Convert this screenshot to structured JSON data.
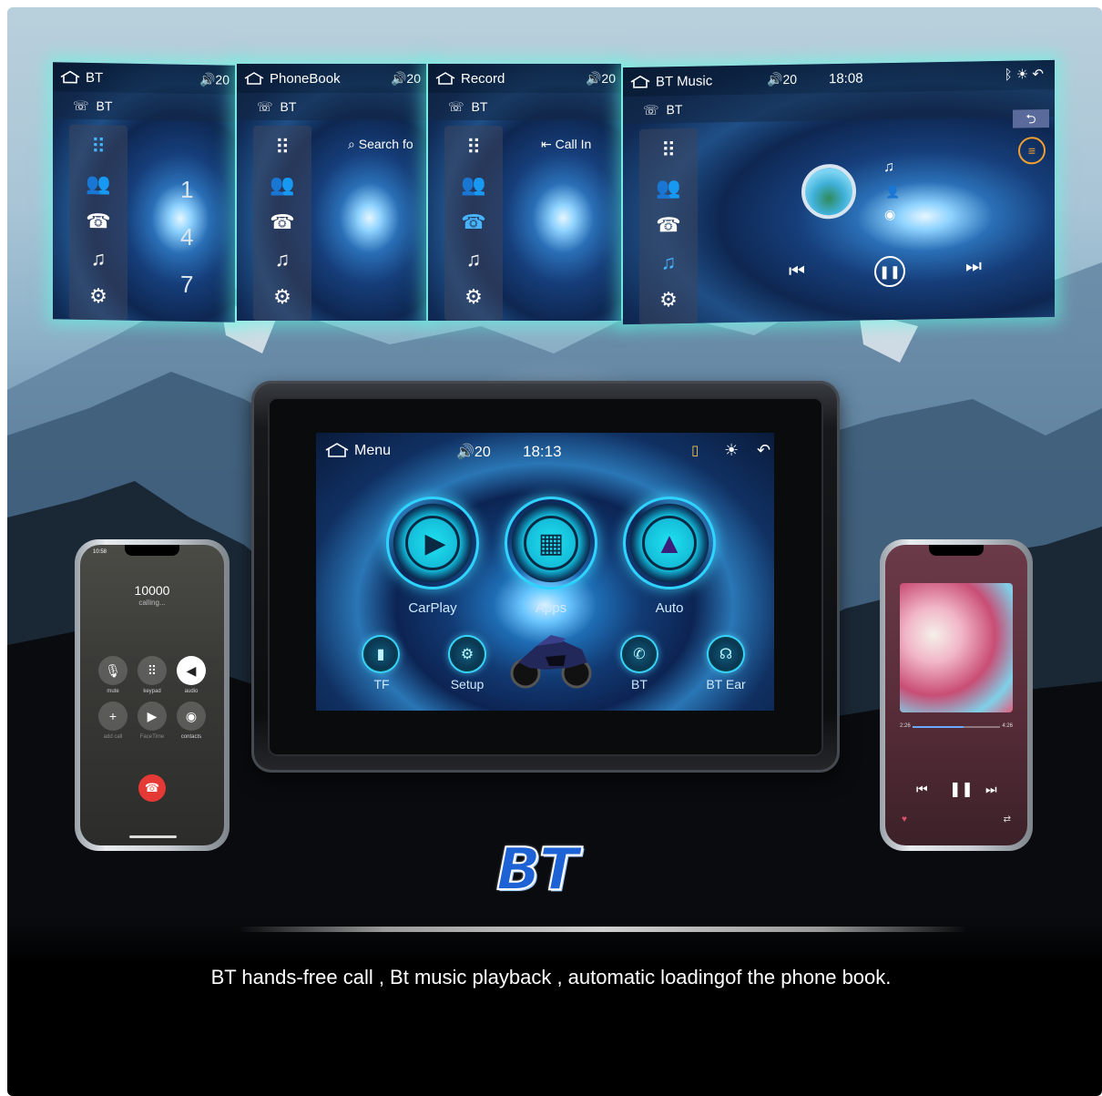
{
  "top_screens": [
    {
      "title": "BT",
      "volume": "20",
      "sub": "BT",
      "extra": "",
      "dial": [
        "1",
        "4",
        "7"
      ]
    },
    {
      "title": "PhoneBook",
      "volume": "20",
      "sub": "BT",
      "extra": "Search fo"
    },
    {
      "title": "Record",
      "volume": "20",
      "sub": "BT",
      "extra": "Call In"
    },
    {
      "title": "BT Music",
      "volume": "20",
      "sub": "BT",
      "time": "18:08"
    }
  ],
  "device": {
    "menu_label": "Menu",
    "volume": "20",
    "time": "18:13",
    "apps": [
      "CarPlay",
      "Apps",
      "Auto"
    ],
    "small_apps": [
      "TF",
      "Setup",
      "BT",
      "BT Ear"
    ]
  },
  "left_phone": {
    "status_time": "10:58",
    "number": "10000",
    "status": "calling...",
    "buttons": [
      "mute",
      "keypad",
      "audio",
      "add call",
      "FaceTime",
      "contacts"
    ]
  },
  "right_phone": {
    "elapsed": "2:26",
    "total": "4:26",
    "progress": 0.58
  },
  "brand_title": "BT",
  "caption": "BT hands-free call , Bt music playback , automatic loadingof the phone book.",
  "colors": {
    "accent": "#46b4ff",
    "glow": "#5affe6",
    "brand": "#1e63d6",
    "end_call": "#e53935"
  }
}
